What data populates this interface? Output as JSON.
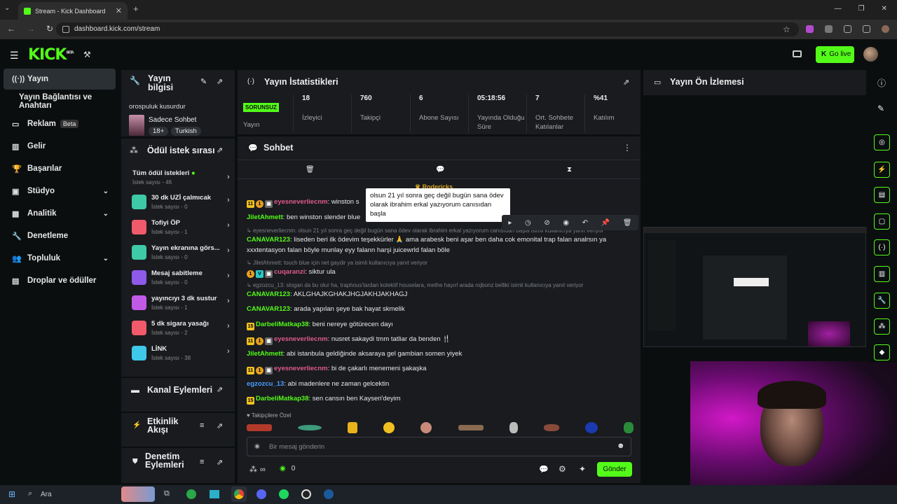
{
  "browser": {
    "tab_title": "Stream - Kick Dashboard",
    "url": "dashboard.kick.com/stream"
  },
  "header": {
    "logo": "KICK",
    "logo_badge": "BETA",
    "go_live": "Go live"
  },
  "sidebar": {
    "items": [
      {
        "label": "Yayın",
        "icon": "broadcast-icon"
      },
      {
        "label": "Yayın Bağlantısı ve Anahtarı"
      },
      {
        "label": "Reklam",
        "icon": "ad-icon",
        "badge": "Beta"
      },
      {
        "label": "Gelir",
        "icon": "chart-icon"
      },
      {
        "label": "Başarılar",
        "icon": "trophy-icon"
      },
      {
        "label": "Stüdyo",
        "icon": "studio-icon"
      },
      {
        "label": "Analitik",
        "icon": "analytics-icon"
      },
      {
        "label": "Denetleme",
        "icon": "wrench-icon"
      },
      {
        "label": "Topluluk",
        "icon": "users-icon"
      },
      {
        "label": "Droplar ve ödüller",
        "icon": "gift-icon"
      }
    ]
  },
  "stream_info": {
    "title": "Yayın bilgisi",
    "stream_title": "orospuluk kusurdur",
    "category": "Sadece Sohbet",
    "tags": [
      "18+",
      "Turkish"
    ]
  },
  "rewards": {
    "title": "Ödül istek sırası",
    "all_label": "Tüm ödül istekleri",
    "all_count": "İstek sayısı - 46",
    "items": [
      {
        "name": "30 dk UZİ çalmıcak",
        "count": "İstek sayısı - 0",
        "color": "#3ec9a7"
      },
      {
        "name": "Tofiyi ÖP",
        "count": "İstek sayısı - 1",
        "color": "#f05a6a"
      },
      {
        "name": "Yayın ekranına görs...",
        "count": "İstek sayısı - 0",
        "color": "#3ec9a7"
      },
      {
        "name": "Mesaj sabitleme",
        "count": "İstek sayısı - 0",
        "color": "#8e5ae8"
      },
      {
        "name": "yayıncıyı 3 dk sustur",
        "count": "İstek sayısı - 1",
        "color": "#c25ae8"
      },
      {
        "name": "5 dk sigara yasağı",
        "count": "İstek sayısı - 2",
        "color": "#f05a6a"
      },
      {
        "name": "LİNK",
        "count": "İstek sayısı - 38",
        "color": "#3ec9e8"
      }
    ]
  },
  "channel_actions": {
    "title": "Kanal Eylemleri"
  },
  "activity_feed": {
    "title": "Etkinlik Akışı"
  },
  "mod_actions": {
    "title": "Denetim Eylemleri"
  },
  "stats": {
    "title": "Yayın İstatistikleri",
    "status": "SORUNSUZ",
    "status_label": "Yayın",
    "items": [
      {
        "value": "18",
        "label": "İzleyici"
      },
      {
        "value": "760",
        "label": "Takipçi"
      },
      {
        "value": "6",
        "label": "Abone Sayısı"
      },
      {
        "value": "05:18:56",
        "label": "Yayında Olduğu Süre"
      },
      {
        "value": "7",
        "label": "Ort. Sohbete Katılanlar"
      },
      {
        "value": "%41",
        "label": "Katılım"
      }
    ]
  },
  "chat": {
    "title": "Sohbet",
    "pinned_user": "Rodericks",
    "tooltip": "olsun 21 yıl sonra geç değil bugün sana ödev olarak ibrahim erkal yazıyorum canısıdan başla",
    "messages": [
      {
        "user": "eyesneverliecnm",
        "color": "#e05a8a",
        "text": "winston s",
        "badges": [
          "sub",
          "gift",
          "mod"
        ]
      },
      {
        "user": "JiletAhmett",
        "color": "#53fc18",
        "text": "ben winston slender blue",
        "badges": []
      },
      {
        "reply": "eyesneverliecnm: olsun 21 yıl sonra geç değil bugün sana ödev olarak ibrahim erkal yazıyorum canısıdan başla isimli kullanıcıya yanıt veriyor"
      },
      {
        "user": "CANAVAR123",
        "color": "#53fc18",
        "text": "liseden beri ilk ödevim teşekkürler 🙏 ama arabesk beni aşar ben daha cok emonital trap falan analrsın ya",
        "badges": []
      },
      {
        "cont": "xxxtentasyon falan böyle munlay eyy falann harşi juicewrld falan böle"
      },
      {
        "reply": "JiletAhmett: touch blue için net gaydir ya isimli kullanıcıya yanıt veriyor"
      },
      {
        "user": "cuqaranzi",
        "color": "#e05a8a",
        "text": "siktur ula",
        "badges": [
          "gift",
          "vip",
          "mod"
        ]
      },
      {
        "reply": "egzozcu_13: slogan da bu olur ha, traphous'lardan kolektif houselara, methe hayırl arada rojbonz belliki isimli kullanıcıya yanıt veriyor"
      },
      {
        "user": "CANAVAR123",
        "color": "#53fc18",
        "text": "AKLGHAJKGHAKJHGJAKHJAKHAGJ",
        "badges": []
      },
      {
        "user": "CANAVAR123",
        "color": "#53fc18",
        "text": "arada yapılan şeye bak hayat skmelik",
        "badges": []
      },
      {
        "user": "DarbeliMatkap38",
        "color": "#53fc18",
        "text": "beni nereye götürecen dayı",
        "badges": [
          "s15"
        ]
      },
      {
        "user": "eyesneverliecnm",
        "color": "#e05a8a",
        "text": "nusret sakaydi tmm tatliar da benden 🍴",
        "badges": [
          "sub",
          "gift",
          "mod"
        ]
      },
      {
        "user": "JiletAhmett",
        "color": "#53fc18",
        "text": "abi istanbula geldiğinde aksaraya gel gambian somen yiyek",
        "badges": []
      },
      {
        "user": "eyesneverliecnm",
        "color": "#e05a8a",
        "text": "bi de çakarlı menemeni şakaşka",
        "badges": [
          "sub",
          "gift",
          "mod"
        ]
      },
      {
        "user": "egzozcu_13",
        "color": "#4a9eff",
        "text": "abi madenlere ne zaman gelcektin",
        "badges": []
      },
      {
        "user": "DarbeliMatkap38",
        "color": "#53fc18",
        "text": "sen cansın ben Kayseri'deyim",
        "badges": [
          "s15"
        ]
      }
    ],
    "emote_label": "Takipçilere Özel",
    "input_placeholder": "Bir mesaj gönderin",
    "send": "Gönder",
    "points": "∞",
    "kick_points": "0"
  },
  "preview": {
    "title": "Yayın Ön İzlemesi"
  },
  "taskbar": {
    "search": "Ara"
  },
  "colors": {
    "accent": "#53fc18",
    "panel": "#191b1f",
    "bg": "#0b0e0f"
  }
}
